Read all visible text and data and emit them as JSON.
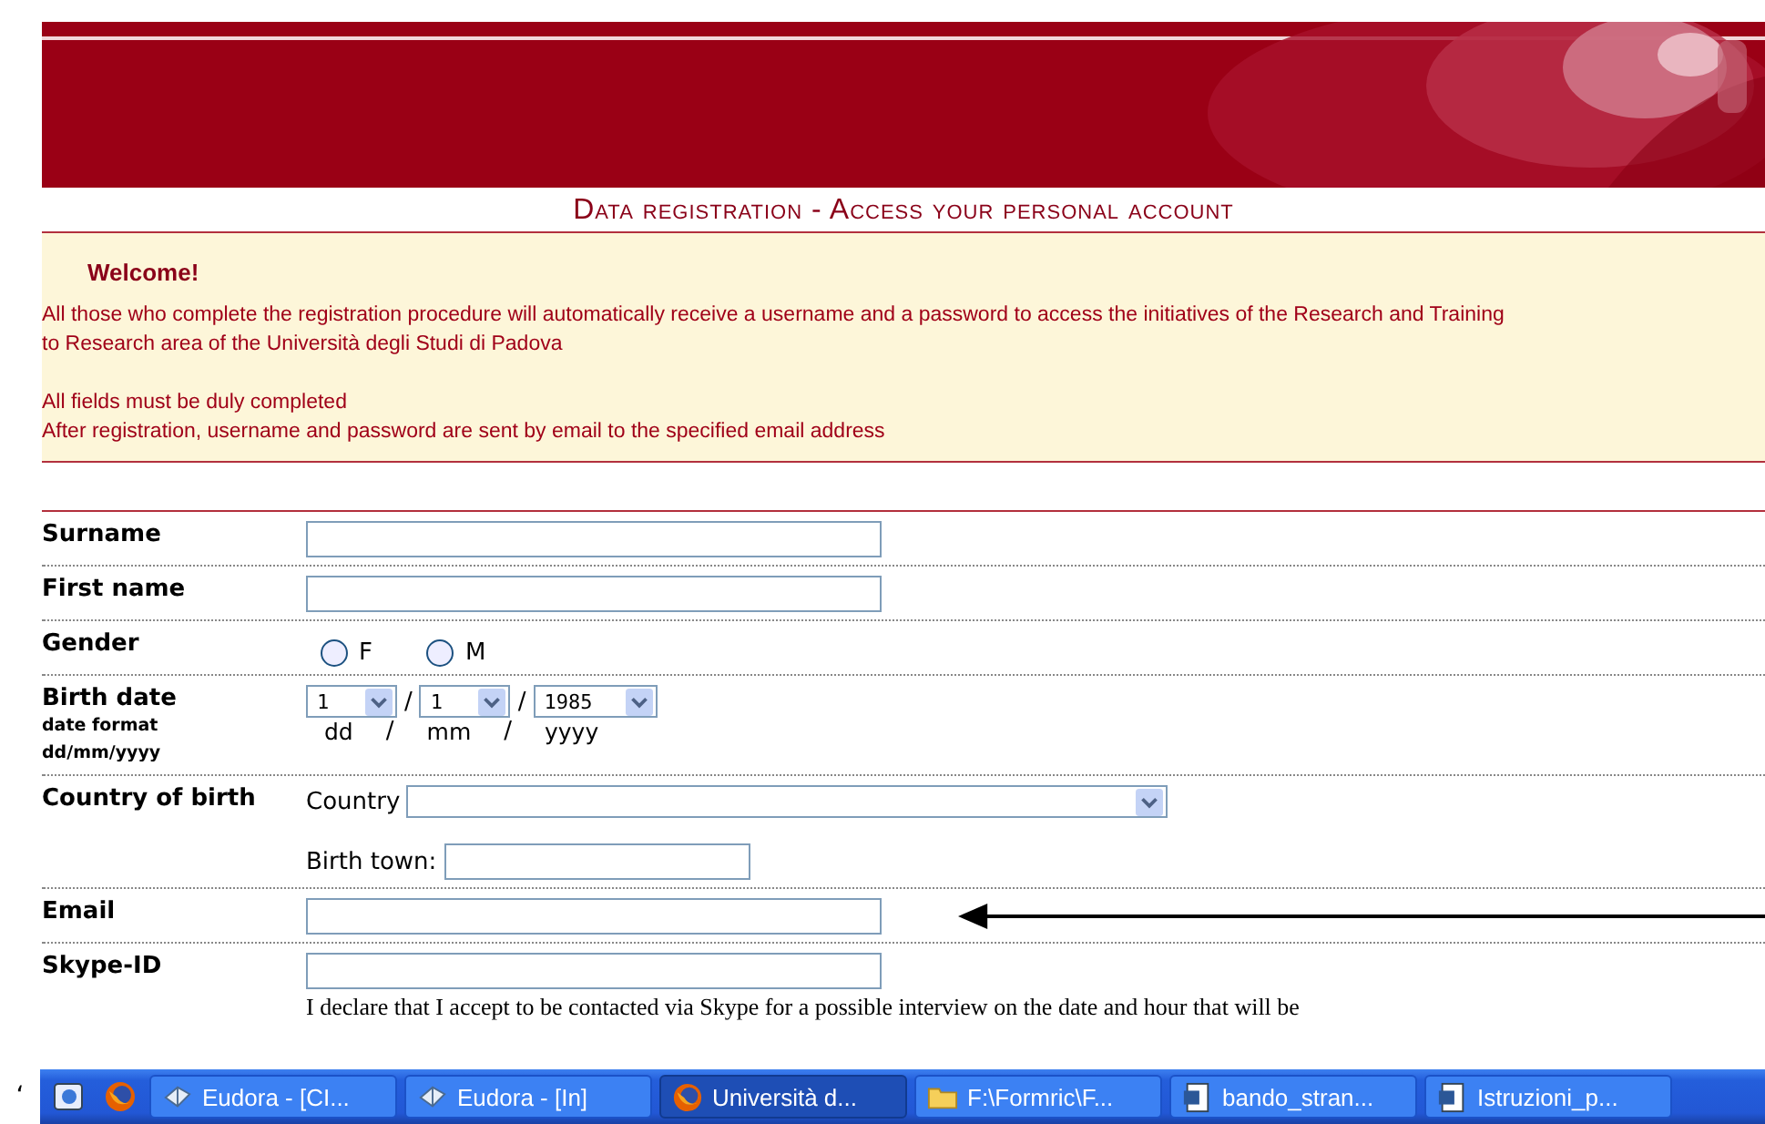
{
  "page_title": "Data registration - Access your personal account",
  "welcome": {
    "title": "Welcome!",
    "paragraphs": [
      [
        "All those who complete the registration procedure will automatically receive a username and a password to access the initiatives of the Research and Training",
        "to Research area of the Università degli Studi di Padova"
      ],
      [
        "All fields must be duly completed",
        "After registration, username and password are sent by email to the specified email address"
      ]
    ]
  },
  "form": [
    {
      "kind": "text",
      "label": "Surname"
    },
    {
      "kind": "text",
      "label": "First name"
    },
    {
      "kind": "radio",
      "label": "Gender",
      "options": [
        {
          "label": "F",
          "selected": false
        },
        {
          "label": "M",
          "selected": false
        }
      ]
    },
    {
      "kind": "date",
      "label": "Birth date",
      "hint_lines": [
        "date format",
        "dd/mm/yyyy"
      ],
      "selects": [
        {
          "value": "1",
          "caption": "dd"
        },
        {
          "value": "1",
          "caption": "mm"
        },
        {
          "value": "1985",
          "caption": "yyyy"
        }
      ],
      "separator": "/"
    },
    {
      "kind": "country",
      "label": "Country of birth",
      "country_label": "Country",
      "town_label": "Birth town:"
    },
    {
      "kind": "text",
      "label": "Email",
      "arrow": true
    },
    {
      "kind": "text",
      "label": "Skype-ID",
      "note": "I declare that I accept to be contacted via Skype for a possible interview on the date and hour that will be"
    }
  ],
  "edge_mark": "‘",
  "taskbar": {
    "items": [
      {
        "kind": "mail",
        "label": "Eudora - [CI...",
        "selected": false
      },
      {
        "kind": "mail",
        "label": "Eudora - [In]",
        "selected": false
      },
      {
        "kind": "browser",
        "label": "Università d...",
        "selected": true
      },
      {
        "kind": "folder",
        "label": "F:\\Formric\\F...",
        "selected": false
      },
      {
        "kind": "document",
        "label": "bando_stran...",
        "selected": false
      },
      {
        "kind": "document",
        "label": "Istruzioni_p...",
        "selected": false
      }
    ]
  }
}
